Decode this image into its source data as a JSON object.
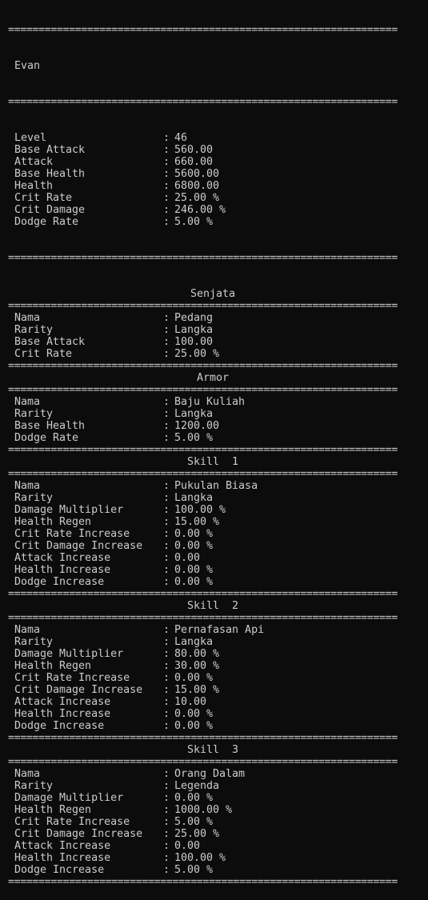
{
  "rule": "================================================================",
  "player": {
    "name": "Evan",
    "stats": [
      {
        "label": "Level",
        "value": "46"
      },
      {
        "label": "Base Attack",
        "value": "560.00"
      },
      {
        "label": "Attack",
        "value": "660.00"
      },
      {
        "label": "Base Health",
        "value": "5600.00"
      },
      {
        "label": "Health",
        "value": "6800.00"
      },
      {
        "label": "Crit Rate",
        "value": "25.00 %"
      },
      {
        "label": "Crit Damage",
        "value": "246.00 %"
      },
      {
        "label": "Dodge Rate",
        "value": "5.00 %"
      }
    ]
  },
  "sections": [
    {
      "title": "Senjata",
      "rows": [
        {
          "label": "Nama",
          "value": "Pedang"
        },
        {
          "label": "Rarity",
          "value": "Langka"
        },
        {
          "label": "Base Attack",
          "value": "100.00"
        },
        {
          "label": "Crit Rate",
          "value": "25.00 %"
        }
      ]
    },
    {
      "title": "Armor",
      "rows": [
        {
          "label": "Nama",
          "value": "Baju Kuliah"
        },
        {
          "label": "Rarity",
          "value": "Langka"
        },
        {
          "label": "Base Health",
          "value": "1200.00"
        },
        {
          "label": "Dodge Rate",
          "value": "5.00 %"
        }
      ]
    },
    {
      "title": "Skill  1",
      "rows": [
        {
          "label": "Nama",
          "value": "Pukulan Biasa"
        },
        {
          "label": "Rarity",
          "value": "Langka"
        },
        {
          "label": "Damage Multiplier",
          "value": "100.00 %"
        },
        {
          "label": "Health Regen",
          "value": "15.00 %"
        },
        {
          "label": "Crit Rate Increase",
          "value": "0.00 %"
        },
        {
          "label": "Crit Damage Increase",
          "value": "0.00 %"
        },
        {
          "label": "Attack Increase",
          "value": "0.00"
        },
        {
          "label": "Health Increase",
          "value": "0.00 %"
        },
        {
          "label": "Dodge Increase",
          "value": "0.00 %"
        }
      ]
    },
    {
      "title": "Skill  2",
      "rows": [
        {
          "label": "Nama",
          "value": "Pernafasan Api"
        },
        {
          "label": "Rarity",
          "value": "Langka"
        },
        {
          "label": "Damage Multiplier",
          "value": "80.00 %"
        },
        {
          "label": "Health Regen",
          "value": "30.00 %"
        },
        {
          "label": "Crit Rate Increase",
          "value": "0.00 %"
        },
        {
          "label": "Crit Damage Increase",
          "value": "15.00 %"
        },
        {
          "label": "Attack Increase",
          "value": "10.00"
        },
        {
          "label": "Health Increase",
          "value": "0.00 %"
        },
        {
          "label": "Dodge Increase",
          "value": "0.00 %"
        }
      ]
    },
    {
      "title": "Skill  3",
      "rows": [
        {
          "label": "Nama",
          "value": "Orang Dalam"
        },
        {
          "label": "Rarity",
          "value": "Legenda"
        },
        {
          "label": "Damage Multiplier",
          "value": "0.00 %"
        },
        {
          "label": "Health Regen",
          "value": "1000.00 %"
        },
        {
          "label": "Crit Rate Increase",
          "value": "5.00 %"
        },
        {
          "label": "Crit Damage Increase",
          "value": "25.00 %"
        },
        {
          "label": "Attack Increase",
          "value": "0.00"
        },
        {
          "label": "Health Increase",
          "value": "100.00 %"
        },
        {
          "label": "Dodge Increase",
          "value": "5.00 %"
        }
      ]
    }
  ],
  "colors": {
    "background": "#0c0c0c",
    "text": "#cccccc"
  }
}
